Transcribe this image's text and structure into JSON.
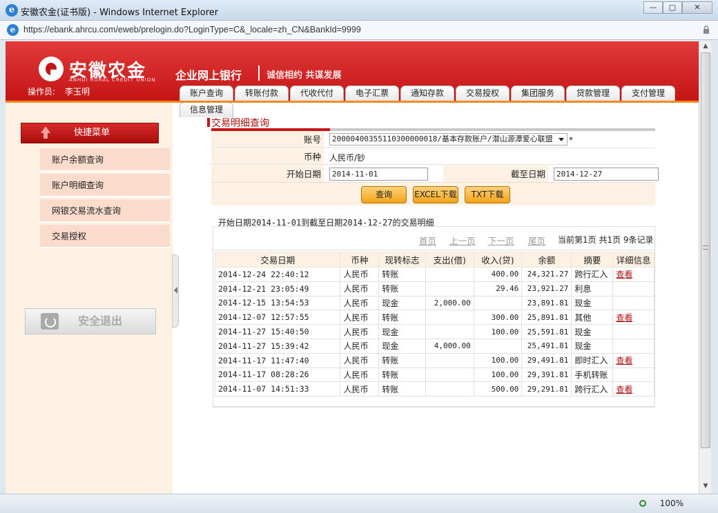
{
  "window": {
    "title": "安徽农金(证书版) - Windows Internet Explorer",
    "url": "https://ebank.ahrcu.com/eweb/prelogin.do?LoginType=C&_locale=zh_CN&BankId=9999",
    "zoom": "100%"
  },
  "header": {
    "logo_cn": "安徽农金",
    "logo_en": "ANHUI RURAL CREDIT UNION",
    "site_title": "企业网上银行",
    "slogan": "诚信相约 共谋发展",
    "operator_label": "操作员:",
    "operator_name": "李玉明"
  },
  "nav": {
    "tabs": [
      "账户查询",
      "转账付款",
      "代收代付",
      "电子汇票",
      "通知存款",
      "交易授权",
      "集团服务",
      "贷款管理",
      "支付管理",
      "信息管理"
    ]
  },
  "sidebar": {
    "quick_menu": "快捷菜单",
    "items": [
      "账户余额查询",
      "账户明细查询",
      "网银交易流水查询",
      "交易授权"
    ],
    "logout": "安全退出"
  },
  "query": {
    "section_title": "交易明细查询",
    "account_label": "账号",
    "account_value": "20000400355110300000018/基本存款账户/潜山源潭爱心联盟",
    "required_mark": "*",
    "currency_label": "币种",
    "currency_value": "人民币/钞",
    "start_label": "开始日期",
    "start_value": "2014-11-01",
    "end_label": "截至日期",
    "end_value": "2014-12-27",
    "buttons": {
      "query": "查询",
      "excel": "EXCEL下载",
      "txt": "TXT下载"
    }
  },
  "result": {
    "title": "开始日期2014-11-01到截至日期2014-12-27的交易明细",
    "pager": {
      "first": "首页",
      "prev": "上一页",
      "next": "下一页",
      "last": "尾页",
      "info": "当前第1页 共1页 9条记录"
    },
    "columns": [
      "交易日期",
      "币种",
      "现转标志",
      "支出(借)",
      "收入(贷)",
      "余额",
      "摘要",
      "详细信息"
    ],
    "rows": [
      {
        "date": "2014-12-24  22:40:12",
        "cur": "人民币",
        "flag": "转账",
        "debit": "",
        "credit": "400.00",
        "balance": "24,321.27",
        "memo": "跨行汇入",
        "detail": "查看"
      },
      {
        "date": "2014-12-21  23:05:49",
        "cur": "人民币",
        "flag": "转账",
        "debit": "",
        "credit": "29.46",
        "balance": "23,921.27",
        "memo": "利息",
        "detail": ""
      },
      {
        "date": "2014-12-15  13:54:53",
        "cur": "人民币",
        "flag": "现金",
        "debit": "2,000.00",
        "credit": "",
        "balance": "23,891.81",
        "memo": "现金",
        "detail": ""
      },
      {
        "date": "2014-12-07  12:57:55",
        "cur": "人民币",
        "flag": "转账",
        "debit": "",
        "credit": "300.00",
        "balance": "25,891.81",
        "memo": "其他",
        "detail": "查看"
      },
      {
        "date": "2014-11-27  15:40:50",
        "cur": "人民币",
        "flag": "现金",
        "debit": "",
        "credit": "100.00",
        "balance": "25,591.81",
        "memo": "现金",
        "detail": ""
      },
      {
        "date": "2014-11-27  15:39:42",
        "cur": "人民币",
        "flag": "现金",
        "debit": "4,000.00",
        "credit": "",
        "balance": "25,491.81",
        "memo": "现金",
        "detail": ""
      },
      {
        "date": "2014-11-17  11:47:40",
        "cur": "人民币",
        "flag": "转账",
        "debit": "",
        "credit": "100.00",
        "balance": "29,491.81",
        "memo": "即时汇入",
        "detail": "查看"
      },
      {
        "date": "2014-11-17  08:28:26",
        "cur": "人民币",
        "flag": "转账",
        "debit": "",
        "credit": "100.00",
        "balance": "29,391.81",
        "memo": "手机转账",
        "detail": ""
      },
      {
        "date": "2014-11-07  14:51:33",
        "cur": "人民币",
        "flag": "转账",
        "debit": "",
        "credit": "500.00",
        "balance": "29,291.81",
        "memo": "跨行汇入",
        "detail": "查看"
      }
    ]
  },
  "colors": {
    "brand_red": "#c41414",
    "accent_orange": "#f08a1f",
    "panel_bg": "#fdf1e4"
  }
}
